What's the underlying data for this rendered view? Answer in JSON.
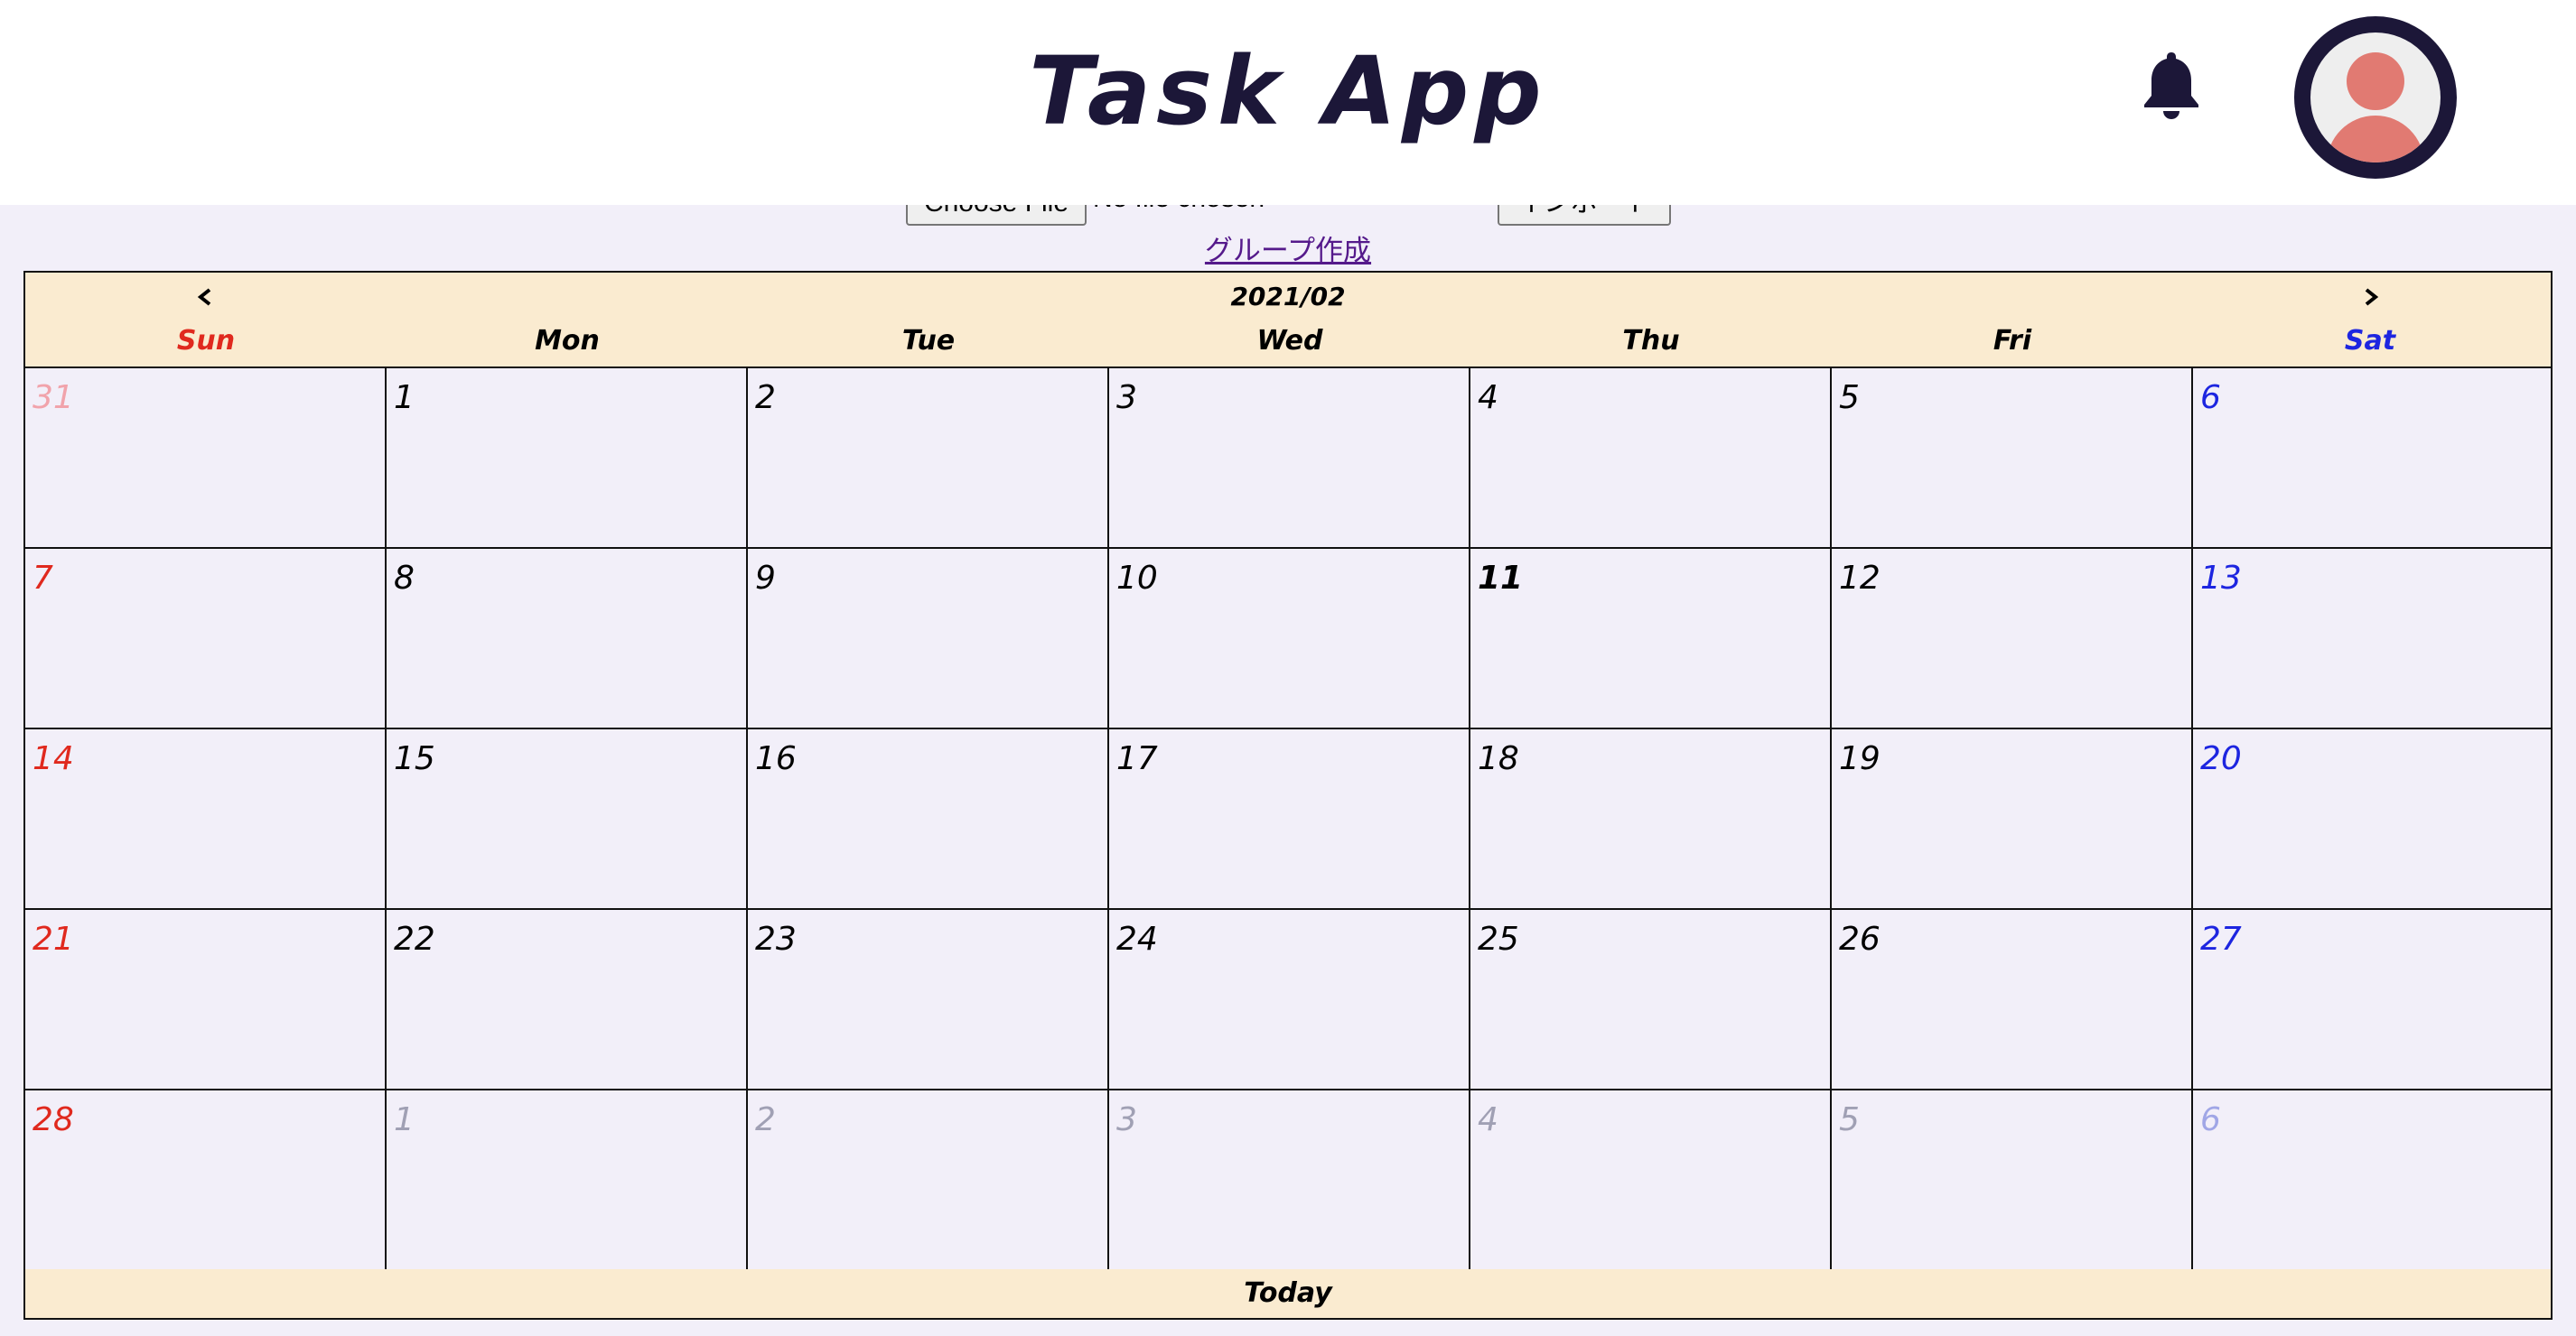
{
  "header": {
    "title": "Task App",
    "icons": {
      "bell": "bell-icon",
      "avatar": "user-avatar-icon"
    }
  },
  "toolbar": {
    "file_button_label": "Choose File",
    "file_status": "No file chosen",
    "import_button_label": "インポート",
    "group_link": "グループ作成"
  },
  "calendar": {
    "prev_label": "◀",
    "next_label": "▶",
    "month": "2021/02",
    "weekdays": [
      "Sun",
      "Mon",
      "Tue",
      "Wed",
      "Thu",
      "Fri",
      "Sat"
    ],
    "today_label": "Today",
    "weeks": [
      [
        "31",
        "1",
        "2",
        "3",
        "4",
        "5",
        "6"
      ],
      [
        "7",
        "8",
        "9",
        "10",
        "11",
        "12",
        "13"
      ],
      [
        "14",
        "15",
        "16",
        "17",
        "18",
        "19",
        "20"
      ],
      [
        "21",
        "22",
        "23",
        "24",
        "25",
        "26",
        "27"
      ],
      [
        "28",
        "1",
        "2",
        "3",
        "4",
        "5",
        "6"
      ]
    ],
    "today_day": "11"
  },
  "colors": {
    "brand_dark": "#1c1738",
    "sunday": "#e0291e",
    "saturday": "#1d25e0",
    "header_band": "#faebd0",
    "background": "#f2eff9",
    "avatar_accent": "#e17a72"
  }
}
